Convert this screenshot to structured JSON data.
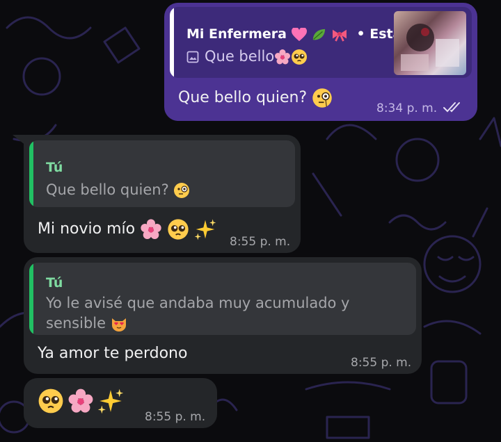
{
  "messages": {
    "m1": {
      "quote_name": "Mi Enfermera",
      "quote_name_emojis": [
        "heart-emoji",
        "leaf-emoji",
        "ribbon-emoji"
      ],
      "quote_suffix": "• Estado",
      "quote_text": "Que bello",
      "quote_text_emojis": [
        "flower-emoji",
        "pleading-face-emoji"
      ],
      "text": "Que bello quien?",
      "text_emoji": "monocle-face-emoji",
      "time": "8:34 p. m.",
      "status": "read-double-check"
    },
    "m2": {
      "quote_name": "Tú",
      "quote_text": "Que bello quien?",
      "quote_text_emoji": "monocle-face-emoji",
      "text": "Mi novio mío",
      "text_emojis": [
        "flower-emoji",
        "pleading-face-emoji",
        "sparkles-emoji"
      ],
      "time": "8:55 p. m."
    },
    "m3": {
      "quote_name": "Tú",
      "quote_line1": "Yo le avisé que andaba muy acumulado y",
      "quote_line2": "sensible",
      "quote_line2_emoji": "heart-eyes-cat-emoji",
      "text": "Ya amor te perdono",
      "time": "8:55 p. m."
    },
    "m4": {
      "emojis": [
        "pleading-face-emoji",
        "flower-emoji",
        "sparkles-emoji"
      ],
      "time": "8:55 p. m."
    }
  },
  "colors": {
    "outgoing_bubble": "#4c3393",
    "incoming_bubble": "#242629",
    "quote_bar_outgoing": "#ffffff",
    "quote_bar_incoming": "#21c063",
    "reply_name_incoming": "#7fdba1",
    "background": "#0b0b0e"
  }
}
